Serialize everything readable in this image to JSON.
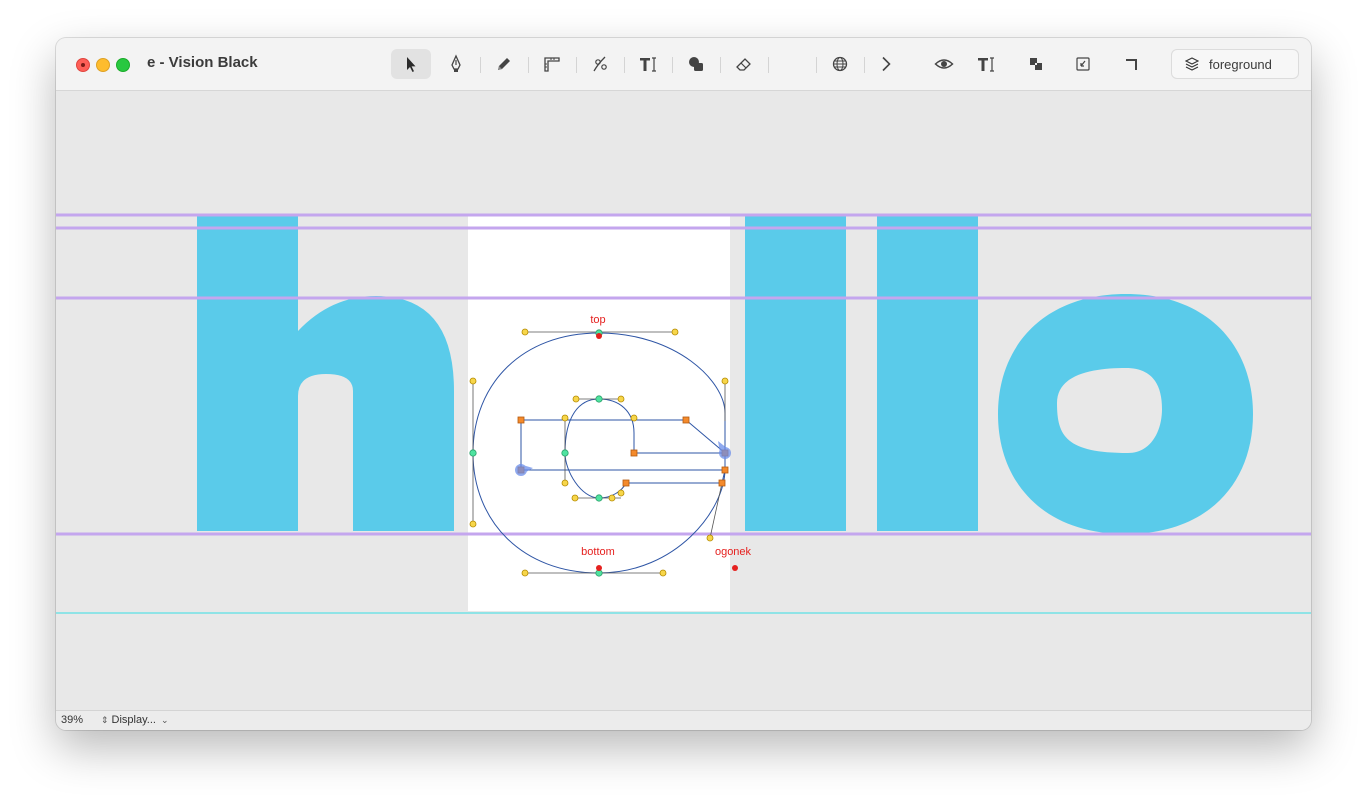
{
  "window": {
    "title": "e - Vision Black"
  },
  "toolbar": {
    "tools": [
      {
        "name": "select-tool",
        "icon": "arrow-pointer-icon",
        "active": true
      },
      {
        "name": "pen-tool",
        "icon": "pen-nib-icon"
      },
      {
        "name": "pencil-tool",
        "icon": "pencil-icon"
      },
      {
        "name": "measure-tool",
        "icon": "ruler-corner-icon"
      },
      {
        "name": "knife-tool",
        "icon": "node-knife-icon"
      },
      {
        "name": "text-tool",
        "icon": "text-cursor-icon"
      },
      {
        "name": "shapes-tool",
        "icon": "shapes-icon"
      },
      {
        "name": "eraser-tool",
        "icon": "eraser-icon"
      },
      {
        "name": "sphere-tool",
        "icon": "globe-grid-icon"
      },
      {
        "name": "next-tool",
        "icon": "chevron-right-icon"
      },
      {
        "name": "preview-toggle",
        "icon": "eye-icon"
      },
      {
        "name": "text-preview-toggle",
        "icon": "text-cursor-icon"
      },
      {
        "name": "layers-toggle",
        "icon": "overlap-squares-icon"
      },
      {
        "name": "component-toggle",
        "icon": "square-arrow-icon"
      },
      {
        "name": "corner-toggle",
        "icon": "corner-icon"
      }
    ],
    "layer_label": "foreground"
  },
  "canvas": {
    "preview_text": "hllo",
    "anchors": {
      "top": "top",
      "bottom": "bottom",
      "ogonek": "ogonek"
    }
  },
  "status": {
    "zoom": "39%",
    "display_label": "Display..."
  },
  "colors": {
    "glyph_fill": "#5acbea",
    "metric_line": "#c4a6ee",
    "baseline_teal": "#8fe3e6",
    "path_stroke": "#2e55a5",
    "anchor_red": "#e5211f"
  }
}
